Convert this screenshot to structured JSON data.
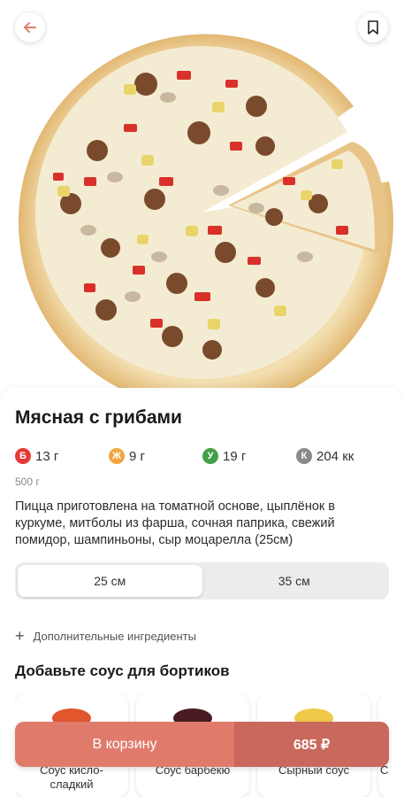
{
  "header": {
    "back_icon": "arrow-left-icon",
    "bookmark_icon": "bookmark-icon"
  },
  "product": {
    "title": "Мясная с грибами",
    "image_alt": "pizza-image",
    "nutrition": [
      {
        "letter": "Б",
        "value": "13 г",
        "color": "#e53935"
      },
      {
        "letter": "Ж",
        "value": "9 г",
        "color": "#f0a742"
      },
      {
        "letter": "У",
        "value": "19 г",
        "color": "#43a047"
      },
      {
        "letter": "К",
        "value": "204 кк",
        "color": "#8a8a8a"
      }
    ],
    "weight": "500 г",
    "description": "Пицца приготовлена на томатной основе, цыплёнок в куркуме, митболы из фарша, сочная паприка, свежий помидор, шампиньоны, сыр моцарелла (25см)"
  },
  "sizes": {
    "options": [
      "25 см",
      "35 см"
    ],
    "selected": "25 см"
  },
  "extras": {
    "label": "Дополнительные ингредиенты"
  },
  "sauces": {
    "title": "Добавьте соус для бортиков",
    "items": [
      {
        "name": "Соус кисло-сладкий",
        "color": "#e2562e"
      },
      {
        "name": "Соус барбекю",
        "color": "#4a1a22"
      },
      {
        "name": "Сырный соус",
        "color": "#f0c94a"
      },
      {
        "name": "С",
        "color": "#dddddd"
      }
    ]
  },
  "cart": {
    "label": "В корзину",
    "price": "685 ₽",
    "accent": "#e07b6c"
  }
}
